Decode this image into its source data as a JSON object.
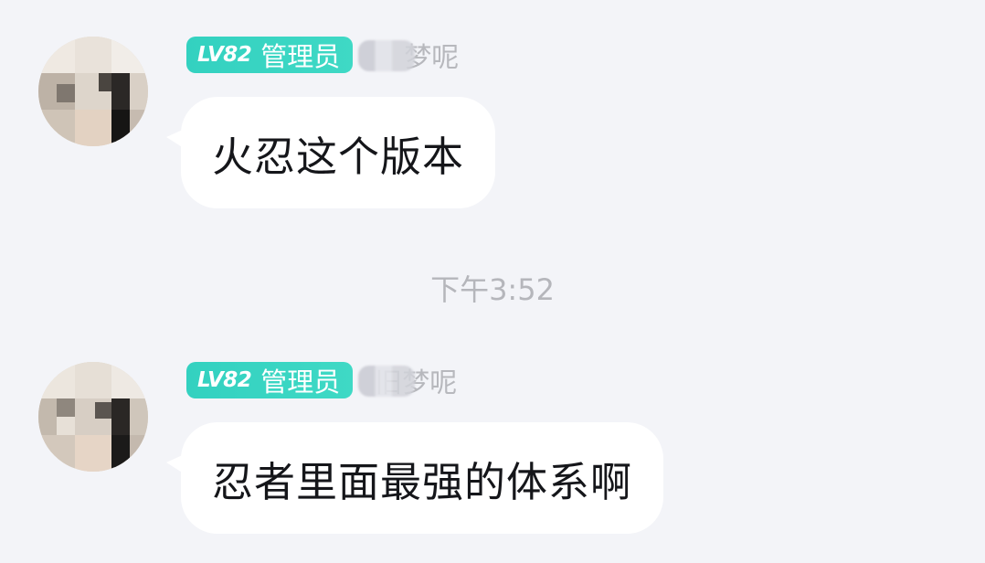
{
  "messages": [
    {
      "badge_level": "LV82",
      "badge_role": "管理员",
      "username": "梦呢",
      "text": "火忍这个版本"
    },
    {
      "badge_level": "LV82",
      "badge_role": "管理员",
      "username": "旧梦呢",
      "text": "忍者里面最强的体系啊"
    }
  ],
  "timestamp": "下午3:52",
  "colors": {
    "background": "#f3f4f8",
    "badge": "#3dd6c4",
    "bubble": "#ffffff",
    "text": "#15161a",
    "muted": "#b5b6bb"
  },
  "icons": {
    "avatar": "pixelated-avatar"
  }
}
